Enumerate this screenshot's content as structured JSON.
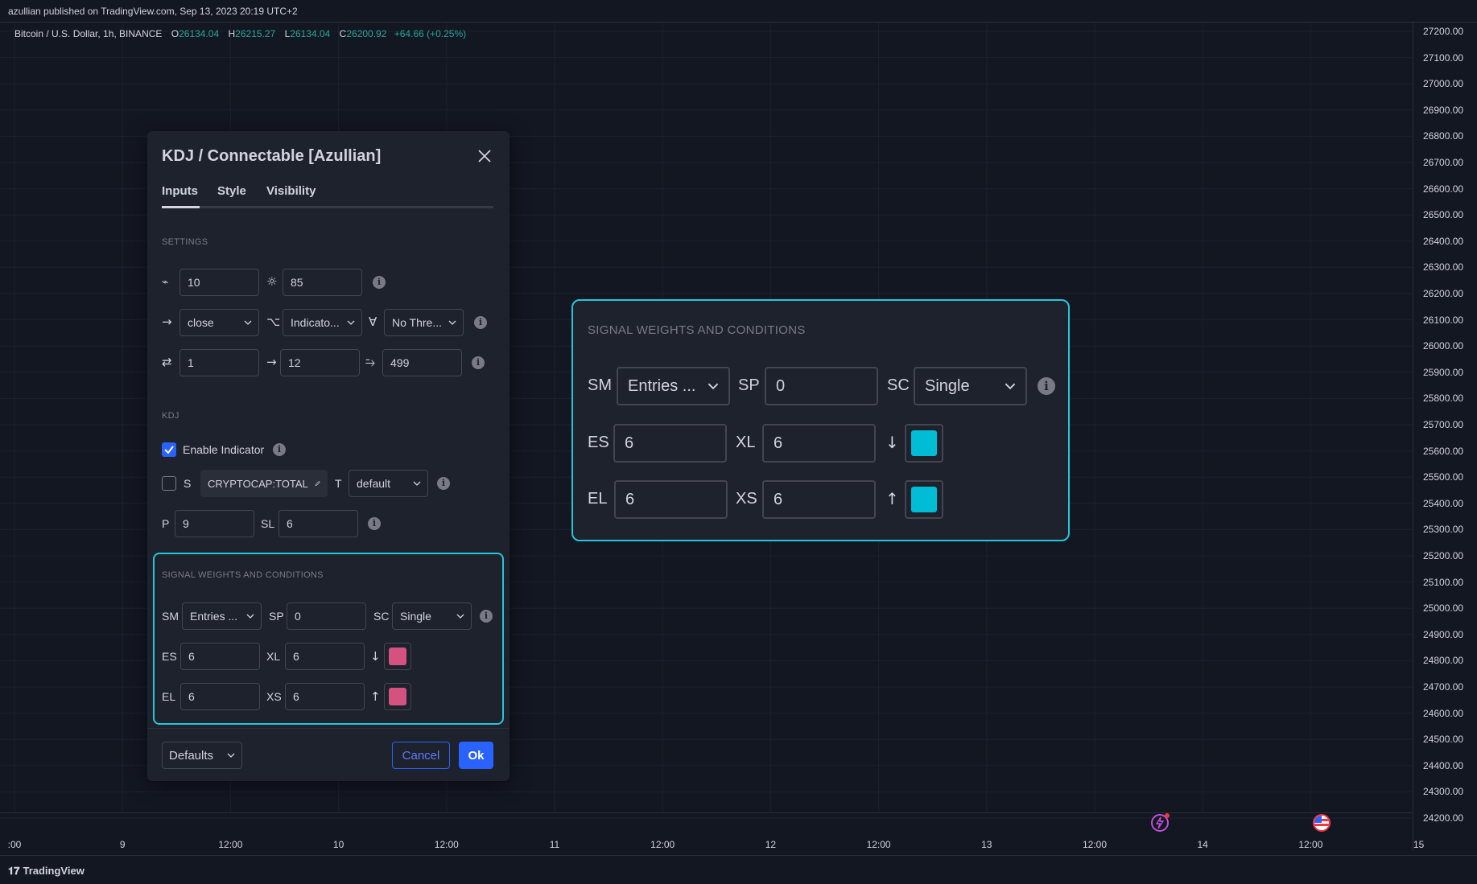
{
  "publish_info": "azullian published on TradingView.com, Sep 13, 2023 20:19 UTC+2",
  "symbol": {
    "name": "Bitcoin / U.S. Dollar, 1h, BINANCE",
    "o_label": "O",
    "o": "26134.04",
    "h_label": "H",
    "h": "26215.27",
    "l_label": "L",
    "l": "26134.04",
    "c_label": "C",
    "c": "26200.92",
    "change": "+64.66 (+0.25%)"
  },
  "price_axis": [
    "27200.00",
    "27100.00",
    "27000.00",
    "26900.00",
    "26800.00",
    "26700.00",
    "26600.00",
    "26500.00",
    "26400.00",
    "26300.00",
    "26200.00",
    "26100.00",
    "26000.00",
    "25900.00",
    "25800.00",
    "25700.00",
    "25600.00",
    "25500.00",
    "25400.00",
    "25300.00",
    "25200.00",
    "25100.00",
    "25000.00",
    "24900.00",
    "24800.00",
    "24700.00",
    "24600.00",
    "24500.00",
    "24400.00",
    "24300.00",
    "24200.00"
  ],
  "time_axis": [
    ":00",
    "9",
    "12:00",
    "10",
    "12:00",
    "11",
    "12:00",
    "12",
    "12:00",
    "13",
    "12:00",
    "14",
    "12:00",
    "15"
  ],
  "footer_brand": "TradingView",
  "colors": {
    "accent": "#2962ff",
    "highlight": "#26c6da",
    "swatch_pink": "#d5527e",
    "swatch_cyan": "#00bcd4",
    "positive": "#26a69a"
  },
  "dialog": {
    "title": "KDJ / Connectable [Azullian]",
    "tabs": [
      "Inputs",
      "Style",
      "Visibility"
    ],
    "active_tab": "Inputs",
    "settings": {
      "section": "SETTINGS",
      "row1": {
        "icon1": "trend-line-icon",
        "v1": "10",
        "icon2": "sun-icon",
        "v2": "85"
      },
      "row2": {
        "icon1": "arrow-right-icon",
        "s1": "close",
        "icon2": "merge-icon",
        "s2": "Indicato...",
        "icon3": "filter-icon",
        "s3": "No Thre..."
      },
      "row3": {
        "icon1": "swap-icon",
        "v1": "1",
        "icon2": "arrow-right-icon",
        "v2": "12",
        "icon3": "approx-icon",
        "v3": "499"
      }
    },
    "kdj": {
      "section": "KDJ",
      "enable_label": "Enable Indicator",
      "enable_checked": true,
      "s_label": "S",
      "s_checked": false,
      "symbol_chip": "CRYPTOCAP:TOTAL",
      "t_label": "T",
      "t_value": "default",
      "p_label": "P",
      "p_value": "9",
      "sl_label": "SL",
      "sl_value": "6"
    },
    "signals": {
      "section": "SIGNAL WEIGHTS AND CONDITIONS",
      "sm_label": "SM",
      "sm_value": "Entries ...",
      "sp_label": "SP",
      "sp_value": "0",
      "sc_label": "SC",
      "sc_value": "Single",
      "es_label": "ES",
      "es_value": "6",
      "xl_label": "XL",
      "xl_value": "6",
      "down_glyph": "↓",
      "el_label": "EL",
      "el_value": "6",
      "xs_label": "XS",
      "xs_value": "6",
      "up_glyph": "↑"
    },
    "footer": {
      "defaults": "Defaults",
      "cancel": "Cancel",
      "ok": "Ok"
    }
  },
  "zoom": {
    "section": "SIGNAL WEIGHTS AND CONDITIONS",
    "sm_label": "SM",
    "sm_value": "Entries ...",
    "sp_label": "SP",
    "sp_value": "0",
    "sc_label": "SC",
    "sc_value": "Single",
    "es_label": "ES",
    "es_value": "6",
    "xl_label": "XL",
    "xl_value": "6",
    "down_glyph": "↓",
    "el_label": "EL",
    "el_value": "6",
    "xs_label": "XS",
    "xs_value": "6",
    "up_glyph": "↑"
  }
}
